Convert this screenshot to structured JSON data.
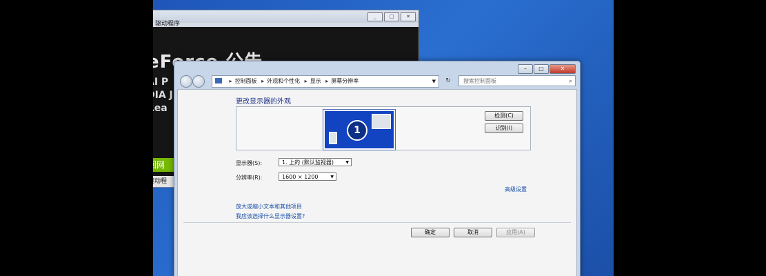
{
  "background_window": {
    "title": "驱动程序",
    "heading": "eForce 公告",
    "lines": [
      "AI P",
      "DIA J",
      "Rea"
    ],
    "green_bar": "回网",
    "driver_bar": "驱动程"
  },
  "window": {
    "breadcrumb": [
      "控制面板",
      "外观和个性化",
      "显示",
      "屏幕分辨率"
    ],
    "search_placeholder": "搜索控制面板"
  },
  "content": {
    "heading": "更改显示器的外观",
    "monitor_number": "1",
    "detect_label": "检测(C)",
    "identify_label": "识别(I)",
    "display_label": "显示器(S):",
    "display_value": "1. 上的 (默认监视器)",
    "resolution_label": "分辨率(R):",
    "resolution_value": "1600 × 1200",
    "advanced_link": "高级设置",
    "link1": "放大或缩小文本和其他项目",
    "link2": "我应该选择什么显示器设置?",
    "ok_label": "确定",
    "cancel_label": "取消",
    "apply_label": "应用(A)"
  },
  "icons": [
    "control-panel-icon",
    "search-icon",
    "refresh-icon",
    "back-icon",
    "forward-icon"
  ]
}
